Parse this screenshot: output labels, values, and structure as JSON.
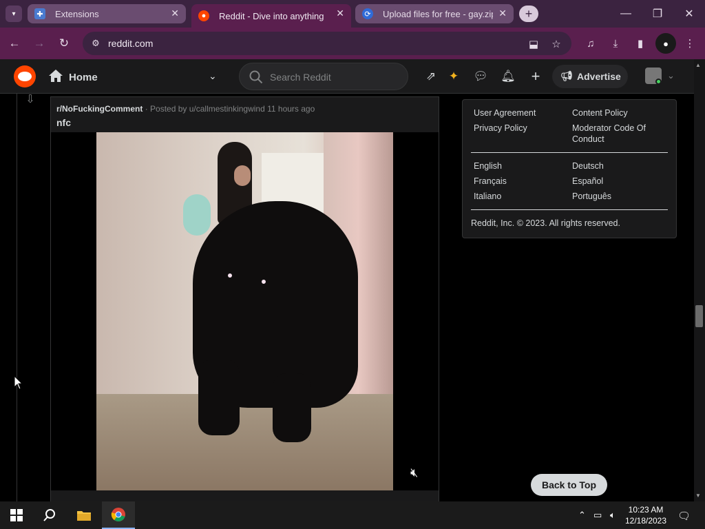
{
  "browser": {
    "tabs": [
      {
        "title": "Extensions",
        "active": false
      },
      {
        "title": "Reddit - Dive into anything",
        "active": true
      },
      {
        "title": "Upload files for free - gay.zip -",
        "active": false
      }
    ],
    "url": "reddit.com"
  },
  "reddit_header": {
    "home_label": "Home",
    "search_placeholder": "Search Reddit",
    "advertise_label": "Advertise"
  },
  "post": {
    "subreddit": "r/NoFuckingComment",
    "byline": "· Posted by u/callmestinkingwind 11 hours ago",
    "title": "nfc"
  },
  "sidebar": {
    "links_col1": [
      "User Agreement",
      "Privacy Policy"
    ],
    "links_col2": [
      "Content Policy",
      "Moderator Code Of",
      "Conduct"
    ],
    "languages_col1": [
      "English",
      "Français",
      "Italiano"
    ],
    "languages_col2": [
      "Deutsch",
      "Español",
      "Português"
    ],
    "copyright": "Reddit, Inc. © 2023. All rights reserved."
  },
  "back_to_top": "Back to Top",
  "taskbar": {
    "time": "10:23 AM",
    "date": "12/18/2023"
  },
  "colors": {
    "reddit_orange": "#ff4500",
    "chrome_frame": "#5a1f4e",
    "reddit_bg": "#1a1a1b"
  }
}
